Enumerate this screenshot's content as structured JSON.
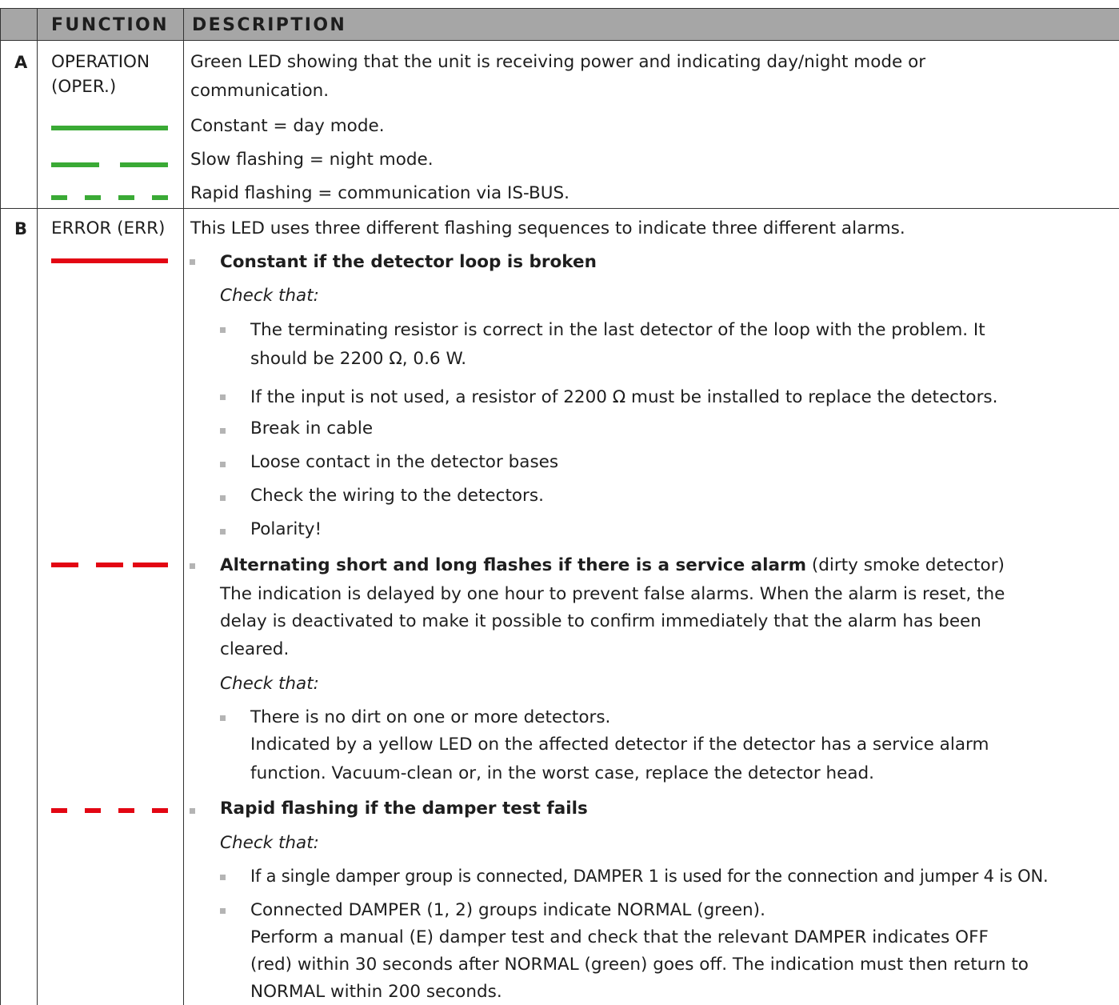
{
  "colors": {
    "header_bg": "#a6a6a6",
    "grid": "#333333",
    "led_green": "#3aaa35",
    "led_red": "#e30613",
    "bullet": "#b4b4b4"
  },
  "header": {
    "function": "FUNCTION",
    "description": "DESCRIPTION"
  },
  "rows": {
    "A": {
      "letter": "A",
      "function_line1": "OPERATION",
      "function_line2": "(OPER.)",
      "desc_line1": "Green LED showing that the unit is receiving power and indicating day/night mode or",
      "desc_line2": "communication.",
      "patterns": {
        "constant": "Constant = day mode.",
        "slow": "Slow flashing = night mode.",
        "rapid": "Rapid flashing = communication via IS-BUS."
      },
      "led_color": "green"
    },
    "B": {
      "letter": "B",
      "function": "ERROR (ERR)",
      "intro": "This LED uses three different flashing sequences to indicate three different alarms.",
      "led_color": "red",
      "alarm1": {
        "title": "Constant if the detector loop is broken",
        "check": "Check that:",
        "items": {
          "i1_line1": "The terminating resistor is correct in the last detector of the loop with the problem. It",
          "i1_line2": "should be 2200 Ω, 0.6 W.",
          "i2": "If the input is not used, a resistor of 2200 Ω must be installed to replace the detectors.",
          "i3": "Break in cable",
          "i4": "Loose contact in the detector bases",
          "i5": "Check the wiring to the detectors.",
          "i6": "Polarity!"
        }
      },
      "alarm2": {
        "title": "Alternating short and long flashes if there is a service alarm",
        "title_suffix": " (dirty smoke detector)",
        "line2": "The indication is delayed by one hour to prevent false alarms. When the alarm is reset, the",
        "line3": "delay is deactivated to make it possible to confirm immediately that the alarm has been",
        "line4": "cleared.",
        "check": "Check that:",
        "item_line1": "There is no dirt on one or more detectors.",
        "item_line2": "Indicated by a yellow LED on the affected detector if the detector has a service alarm",
        "item_line3": "function. Vacuum-clean or, in the worst case, replace the detector head."
      },
      "alarm3": {
        "title": "Rapid flashing if the damper test fails",
        "check": "Check that:",
        "i1": "If a single damper group is connected, DAMPER 1 is used for the connection and jumper 4 is ON.",
        "i2_line1": "Connected DAMPER (1, 2) groups indicate NORMAL (green).",
        "i2_line2": "Perform a manual (E) damper test and check that the relevant DAMPER indicates OFF",
        "i2_line3": "(red) within 30 seconds after NORMAL (green) goes off. The indication must then return to",
        "i2_line4": "NORMAL within 200 seconds."
      }
    }
  }
}
